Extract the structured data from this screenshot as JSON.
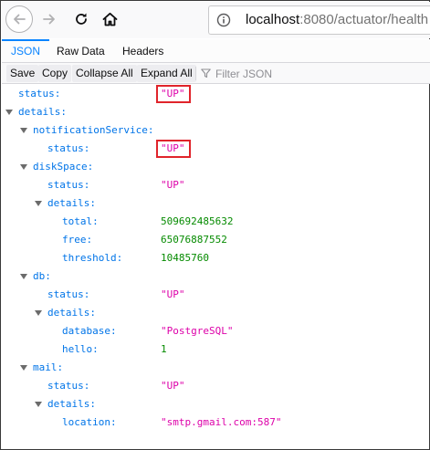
{
  "browser": {
    "url_host": "localhost",
    "url_rest": ":8080/actuator/health",
    "nav_icons": [
      "back-arrow-icon",
      "forward-arrow-icon",
      "reload-icon",
      "home-icon",
      "info-icon"
    ]
  },
  "viewer": {
    "tabs": [
      "JSON",
      "Raw Data",
      "Headers"
    ],
    "active_tab": "JSON",
    "toolbar": {
      "save": "Save",
      "copy": "Copy",
      "collapse_all": "Collapse All",
      "expand_all": "Expand All",
      "filter_placeholder": "Filter JSON"
    }
  },
  "colors": {
    "key": "#0074e8",
    "string": "#dd00a9",
    "number": "#058b00",
    "highlight": "#e0242b",
    "accent": "#0a84ff"
  },
  "tree": [
    {
      "key": "status:",
      "value": "\"UP\"",
      "kind": "string",
      "highlighted": true
    },
    {
      "key": "details:",
      "expandable": true
    },
    {
      "key": "notificationService:",
      "expandable": true
    },
    {
      "key": "status:",
      "value": "\"UP\"",
      "kind": "string",
      "highlighted": true
    },
    {
      "key": "diskSpace:",
      "expandable": true
    },
    {
      "key": "status:",
      "value": "\"UP\"",
      "kind": "string"
    },
    {
      "key": "details:",
      "expandable": true
    },
    {
      "key": "total:",
      "value": "509692485632",
      "kind": "number"
    },
    {
      "key": "free:",
      "value": "65076887552",
      "kind": "number"
    },
    {
      "key": "threshold:",
      "value": "10485760",
      "kind": "number"
    },
    {
      "key": "db:",
      "expandable": true
    },
    {
      "key": "status:",
      "value": "\"UP\"",
      "kind": "string"
    },
    {
      "key": "details:",
      "expandable": true
    },
    {
      "key": "database:",
      "value": "\"PostgreSQL\"",
      "kind": "string"
    },
    {
      "key": "hello:",
      "value": "1",
      "kind": "number"
    },
    {
      "key": "mail:",
      "expandable": true
    },
    {
      "key": "status:",
      "value": "\"UP\"",
      "kind": "string"
    },
    {
      "key": "details:",
      "expandable": true
    },
    {
      "key": "location:",
      "value": "\"smtp.gmail.com:587\"",
      "kind": "string"
    }
  ]
}
